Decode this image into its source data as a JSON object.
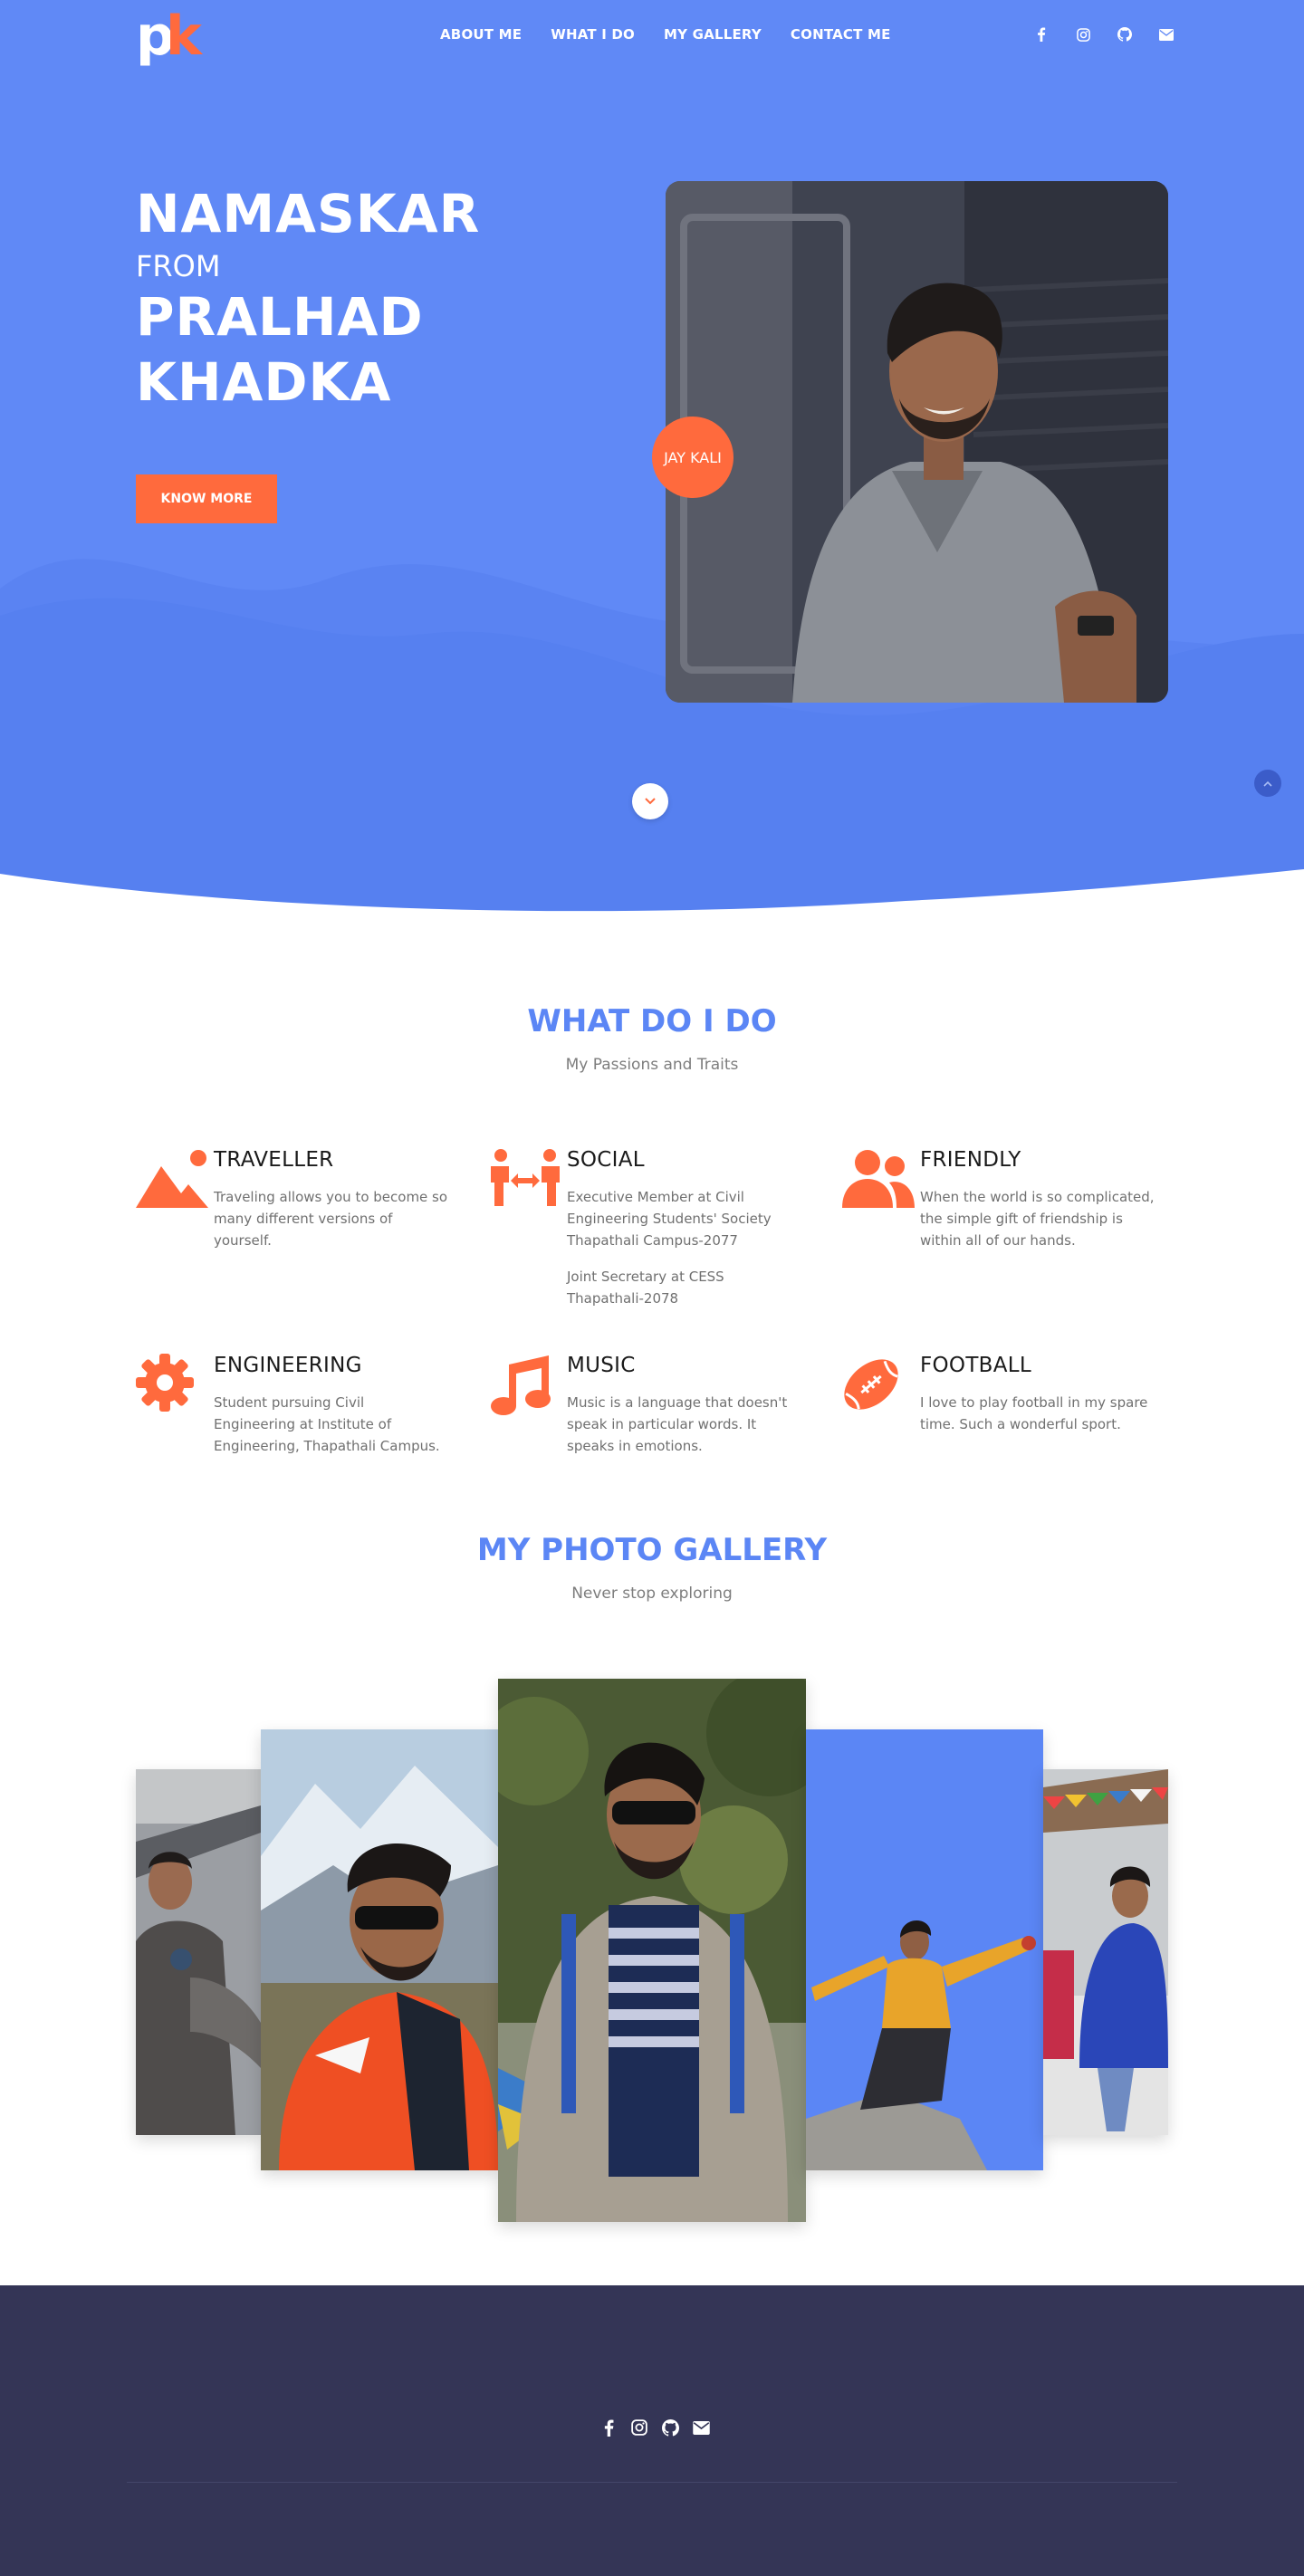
{
  "brand": {
    "logo_text": "pk",
    "colors": {
      "primary": "#5b86f5",
      "accent": "#ff6a3d",
      "footer": "#343556"
    }
  },
  "nav": {
    "links": [
      "ABOUT ME",
      "WHAT I DO",
      "MY GALLERY",
      "CONTACT ME"
    ],
    "social_icons": [
      "facebook-icon",
      "instagram-icon",
      "github-icon",
      "envelope-icon"
    ]
  },
  "hero": {
    "line1": "NAMASKAR",
    "line2": "FROM",
    "line3": "PRALHAD",
    "line4": "KHADKA",
    "button_label": "KNOW MORE",
    "badge_label": "JAY KALI"
  },
  "services": {
    "title": "WHAT DO I DO",
    "subtitle": "My Passions and Traits",
    "items": [
      {
        "icon": "mountain-icon",
        "title": "TRAVELLER",
        "paragraphs": [
          "Traveling allows you to become so many different versions of yourself."
        ]
      },
      {
        "icon": "people-arrows-icon",
        "title": "SOCIAL",
        "paragraphs": [
          "Executive Member at Civil Engineering Students' Society Thapathali Campus-2077",
          "Joint Secretary at CESS Thapathali-2078"
        ]
      },
      {
        "icon": "user-friends-icon",
        "title": "FRIENDLY",
        "paragraphs": [
          "When the world is so complicated, the simple gift of friendship is within all of our hands."
        ]
      },
      {
        "icon": "gear-icon",
        "title": "ENGINEERING",
        "paragraphs": [
          "Student pursuing Civil Engineering at Institute of Engineering, Thapathali Campus."
        ]
      },
      {
        "icon": "music-icon",
        "title": "MUSIC",
        "paragraphs": [
          "Music is a language that doesn't speak in particular words. It speaks in emotions."
        ]
      },
      {
        "icon": "football-icon",
        "title": "FOOTBALL",
        "paragraphs": [
          "I love to play football in my spare time. Such a wonderful sport."
        ]
      }
    ]
  },
  "gallery": {
    "title": "MY PHOTO GALLERY",
    "subtitle": "Never stop exploring"
  },
  "footer": {
    "social_icons": [
      "facebook-icon",
      "instagram-icon",
      "github-icon",
      "envelope-icon"
    ]
  }
}
